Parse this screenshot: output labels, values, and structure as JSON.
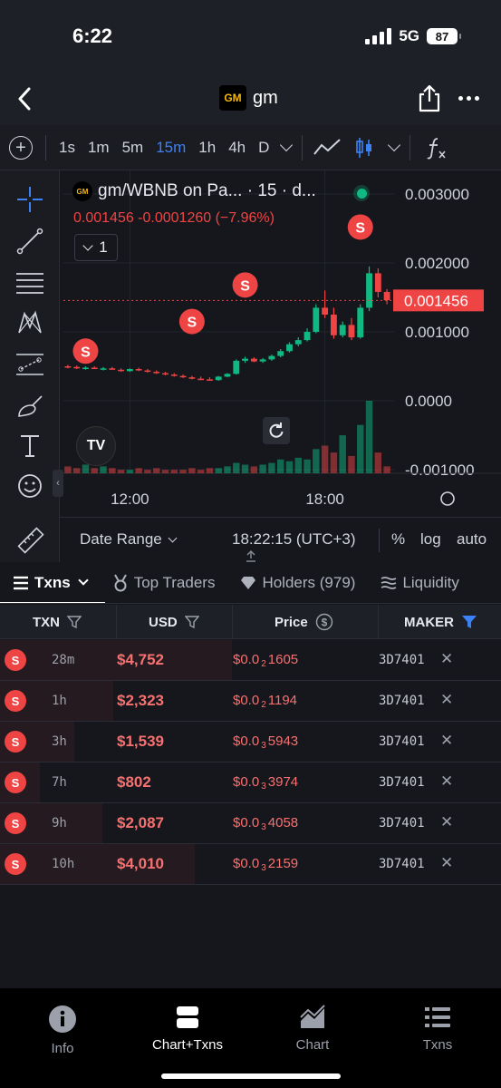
{
  "status": {
    "time": "6:22",
    "network": "5G",
    "battery": "87"
  },
  "header": {
    "logo": "GM",
    "title": "gm"
  },
  "timeframes": [
    {
      "label": "1s",
      "active": false
    },
    {
      "label": "1m",
      "active": false
    },
    {
      "label": "5m",
      "active": false
    },
    {
      "label": "15m",
      "active": true
    },
    {
      "label": "1h",
      "active": false
    },
    {
      "label": "4h",
      "active": false
    },
    {
      "label": "D",
      "active": false
    }
  ],
  "chart": {
    "logo": "GM",
    "title": "gm/WBNB on Pa...  · 15 · d...",
    "ohlc": "0.001456  -0.0001260 (−7.96%)",
    "indicator_count": "1",
    "tv_logo": "TV",
    "date_range": "Date Range",
    "clock": "18:22:15 (UTC+3)",
    "pct": "%",
    "log": "log",
    "auto": "auto",
    "colors": {
      "up": "#10b981",
      "down": "#ef4444",
      "price_tag": "#ef4444"
    }
  },
  "chart_data": {
    "type": "candlestick",
    "title": "gm/WBNB",
    "y_ticks": [
      "0.003000",
      "0.002000",
      "0.001000",
      "0.0000",
      "-0.001000"
    ],
    "x_ticks": [
      "12:00",
      "18:00"
    ],
    "last_price": "0.001456",
    "ylim": [
      -0.001,
      0.003
    ],
    "series": [
      {
        "name": "price",
        "values": [
          [
            0.0005,
            0.00052,
            0.00047,
            0.00049
          ],
          [
            0.00049,
            0.00051,
            0.00046,
            0.00047
          ],
          [
            0.00047,
            0.0005,
            0.00045,
            0.00048
          ],
          [
            0.00048,
            0.0005,
            0.00046,
            0.00046
          ],
          [
            0.00046,
            0.00049,
            0.00044,
            0.00047
          ],
          [
            0.00047,
            0.00049,
            0.00045,
            0.00045
          ],
          [
            0.00045,
            0.00047,
            0.00042,
            0.00043
          ],
          [
            0.00043,
            0.00047,
            0.00042,
            0.00046
          ],
          [
            0.00046,
            0.00048,
            0.00043,
            0.00044
          ],
          [
            0.00044,
            0.00046,
            0.00041,
            0.00042
          ],
          [
            0.00042,
            0.00044,
            0.00039,
            0.0004
          ],
          [
            0.0004,
            0.00042,
            0.00037,
            0.00038
          ],
          [
            0.00038,
            0.0004,
            0.00035,
            0.00036
          ],
          [
            0.00036,
            0.00038,
            0.00033,
            0.00034
          ],
          [
            0.00034,
            0.00036,
            0.00031,
            0.00032
          ],
          [
            0.00032,
            0.00035,
            0.0003,
            0.00031
          ],
          [
            0.00031,
            0.00034,
            0.00029,
            0.0003
          ],
          [
            0.0003,
            0.00036,
            0.00029,
            0.00035
          ],
          [
            0.00035,
            0.0004,
            0.00034,
            0.00039
          ],
          [
            0.00039,
            0.0006,
            0.00038,
            0.00058
          ],
          [
            0.00058,
            0.00064,
            0.00055,
            0.00061
          ],
          [
            0.00061,
            0.00063,
            0.00056,
            0.00057
          ],
          [
            0.00057,
            0.00062,
            0.00055,
            0.0006
          ],
          [
            0.0006,
            0.00067,
            0.00058,
            0.00065
          ],
          [
            0.00065,
            0.00075,
            0.00063,
            0.00072
          ],
          [
            0.00072,
            0.00085,
            0.0007,
            0.00082
          ],
          [
            0.00082,
            0.00092,
            0.00079,
            0.00088
          ],
          [
            0.00088,
            0.00105,
            0.00086,
            0.001
          ],
          [
            0.001,
            0.0014,
            0.00098,
            0.00135
          ],
          [
            0.00135,
            0.0016,
            0.0012,
            0.00125
          ],
          [
            0.00125,
            0.00135,
            0.0009,
            0.00095
          ],
          [
            0.00095,
            0.00115,
            0.00092,
            0.0011
          ],
          [
            0.0011,
            0.0012,
            0.00088,
            0.00092
          ],
          [
            0.00092,
            0.0014,
            0.0009,
            0.00135
          ],
          [
            0.00135,
            0.00195,
            0.0013,
            0.00185
          ],
          [
            0.00185,
            0.00192,
            0.0015,
            0.00158
          ],
          [
            0.00158,
            0.00162,
            0.0014,
            0.00146
          ]
        ],
        "volume": [
          4,
          3,
          5,
          3,
          4,
          3,
          2,
          2,
          3,
          2,
          3,
          2,
          2,
          2,
          3,
          2,
          3,
          3,
          4,
          6,
          5,
          4,
          5,
          6,
          8,
          7,
          9,
          8,
          14,
          16,
          12,
          22,
          10,
          28,
          42,
          12,
          4
        ]
      }
    ],
    "sell_markers": [
      {
        "candle": 2,
        "price": 0.00072
      },
      {
        "candle": 14,
        "price": 0.00115
      },
      {
        "candle": 20,
        "price": 0.00168
      },
      {
        "candle": 33,
        "price": 0.00252
      }
    ]
  },
  "tabs": [
    {
      "label": "Txns",
      "active": true
    },
    {
      "label": "Top Traders",
      "active": false
    },
    {
      "label": "Holders (979)",
      "active": false
    },
    {
      "label": "Liquidity",
      "active": false
    }
  ],
  "table": {
    "headers": {
      "txn": "TXN",
      "usd": "USD",
      "price": "Price",
      "maker": "MAKER"
    },
    "rows": [
      {
        "type": "S",
        "age": "28m",
        "usd": "$4,752",
        "price_prefix": "$0.0",
        "price_zeros": "2",
        "price_digits": "1605",
        "maker": "3D7401",
        "heat": 1.0
      },
      {
        "type": "S",
        "age": "1h",
        "usd": "$2,323",
        "price_prefix": "$0.0",
        "price_zeros": "2",
        "price_digits": "1194",
        "maker": "3D7401",
        "heat": 0.49
      },
      {
        "type": "S",
        "age": "3h",
        "usd": "$1,539",
        "price_prefix": "$0.0",
        "price_zeros": "3",
        "price_digits": "5943",
        "maker": "3D7401",
        "heat": 0.32
      },
      {
        "type": "S",
        "age": "7h",
        "usd": "$802",
        "price_prefix": "$0.0",
        "price_zeros": "3",
        "price_digits": "3974",
        "maker": "3D7401",
        "heat": 0.17
      },
      {
        "type": "S",
        "age": "9h",
        "usd": "$2,087",
        "price_prefix": "$0.0",
        "price_zeros": "3",
        "price_digits": "4058",
        "maker": "3D7401",
        "heat": 0.44
      },
      {
        "type": "S",
        "age": "10h",
        "usd": "$4,010",
        "price_prefix": "$0.0",
        "price_zeros": "3",
        "price_digits": "2159",
        "maker": "3D7401",
        "heat": 0.84
      }
    ]
  },
  "bottom_nav": [
    {
      "label": "Info",
      "icon": "info-icon",
      "active": false
    },
    {
      "label": "Chart+Txns",
      "icon": "split-view-icon",
      "active": true
    },
    {
      "label": "Chart",
      "icon": "chart-icon",
      "active": false
    },
    {
      "label": "Txns",
      "icon": "list-icon",
      "active": false
    }
  ]
}
